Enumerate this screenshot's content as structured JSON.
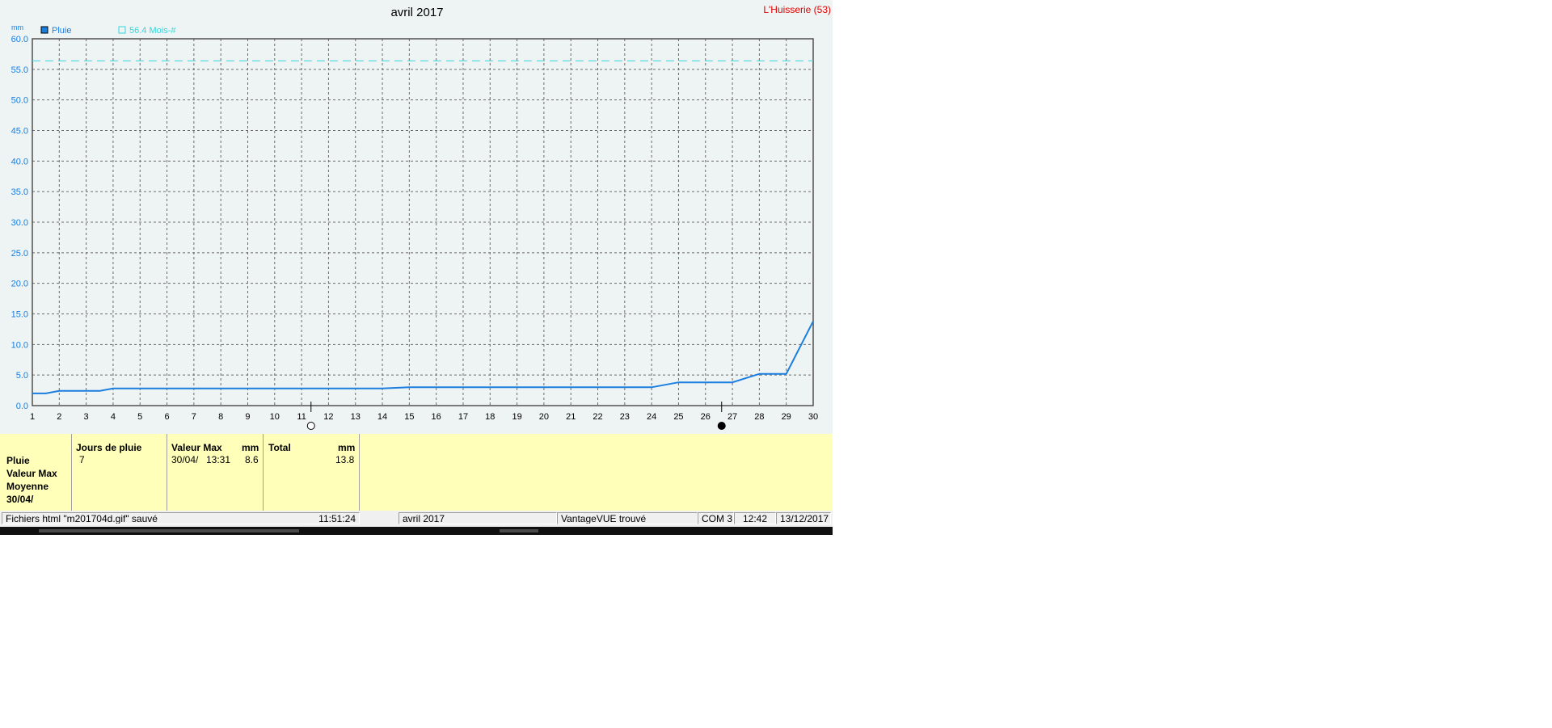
{
  "site_label": "L'Huisserie (53)",
  "chart_data": {
    "type": "line",
    "title": "avril 2017",
    "ylabel": "mm",
    "xlabel": "",
    "x_ticks": [
      1,
      2,
      3,
      4,
      5,
      6,
      7,
      8,
      9,
      10,
      11,
      12,
      13,
      14,
      15,
      16,
      17,
      18,
      19,
      20,
      21,
      22,
      23,
      24,
      25,
      26,
      27,
      28,
      29,
      30
    ],
    "y_ticks": [
      "0.0",
      "5.0",
      "10.0",
      "15.0",
      "20.0",
      "25.0",
      "30.0",
      "35.0",
      "40.0",
      "45.0",
      "50.0",
      "55.0",
      "60.0"
    ],
    "xlim": [
      1,
      30
    ],
    "ylim": [
      0,
      60
    ],
    "grid": true,
    "legend_position": "top-left",
    "series": [
      {
        "name": "Pluie",
        "color": "#1a7ee0",
        "points": [
          [
            1,
            2.0
          ],
          [
            1.5,
            2.0
          ],
          [
            2,
            2.4
          ],
          [
            3,
            2.4
          ],
          [
            3.5,
            2.4
          ],
          [
            4,
            2.8
          ],
          [
            14,
            2.8
          ],
          [
            15,
            3.0
          ],
          [
            24,
            3.0
          ],
          [
            25,
            3.8
          ],
          [
            27,
            3.8
          ],
          [
            28,
            5.2
          ],
          [
            29,
            5.2
          ],
          [
            30,
            13.8
          ]
        ]
      },
      {
        "name": "56.4 Mois-#",
        "color": "#33d6dc",
        "style": "dashed",
        "points": [
          [
            1,
            56.4
          ],
          [
            30,
            56.4
          ]
        ]
      }
    ],
    "moon_markers": [
      {
        "x": 11.35,
        "phase": "full-moon-icon"
      },
      {
        "x": 26.6,
        "phase": "new-moon-icon"
      }
    ]
  },
  "stats": {
    "row_labels": [
      "Pluie",
      "Valeur Max",
      "Moyenne",
      "30/04/"
    ],
    "jours": {
      "header": "Jours de pluie",
      "value": "7"
    },
    "valeur_max": {
      "header": "Valeur Max",
      "unit": "mm",
      "date": "30/04/",
      "time": "13:31",
      "value": "8.6"
    },
    "total": {
      "header": "Total",
      "unit": "mm",
      "value": "13.8"
    }
  },
  "status_bar": {
    "message": "Fichiers html  \"m201704d.gif\"  sauvé",
    "time": "11:51:24",
    "period": "avril 2017",
    "station": "VantageVUE trouvé",
    "port": "COM 3",
    "clock": "12:42",
    "date": "13/12/2017"
  }
}
